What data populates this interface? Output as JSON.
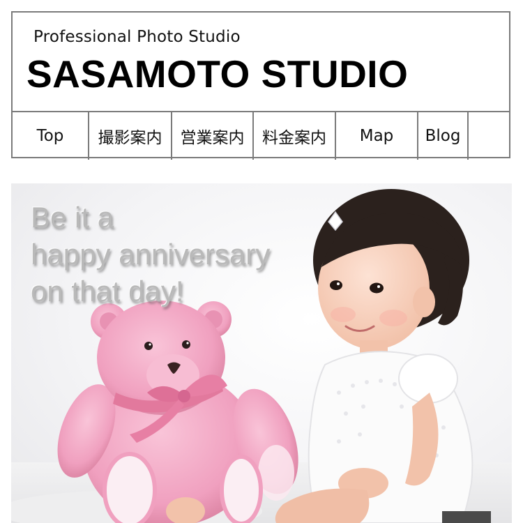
{
  "header": {
    "tagline": "Professional Photo Studio",
    "brand": "SASAMOTO STUDIO"
  },
  "nav": {
    "items": [
      {
        "label": "Top"
      },
      {
        "label": "撮影案内"
      },
      {
        "label": "営業案内"
      },
      {
        "label": "料金案内"
      },
      {
        "label": "Map"
      },
      {
        "label": "Blog"
      },
      {
        "label": ""
      }
    ]
  },
  "hero": {
    "lines": [
      "Be it a",
      "happy anniversary",
      "on that day!"
    ]
  },
  "colors": {
    "border": "#7a7a7a",
    "bear_pink": "#f3a6c3",
    "hero_text": "#b9b9b9"
  }
}
